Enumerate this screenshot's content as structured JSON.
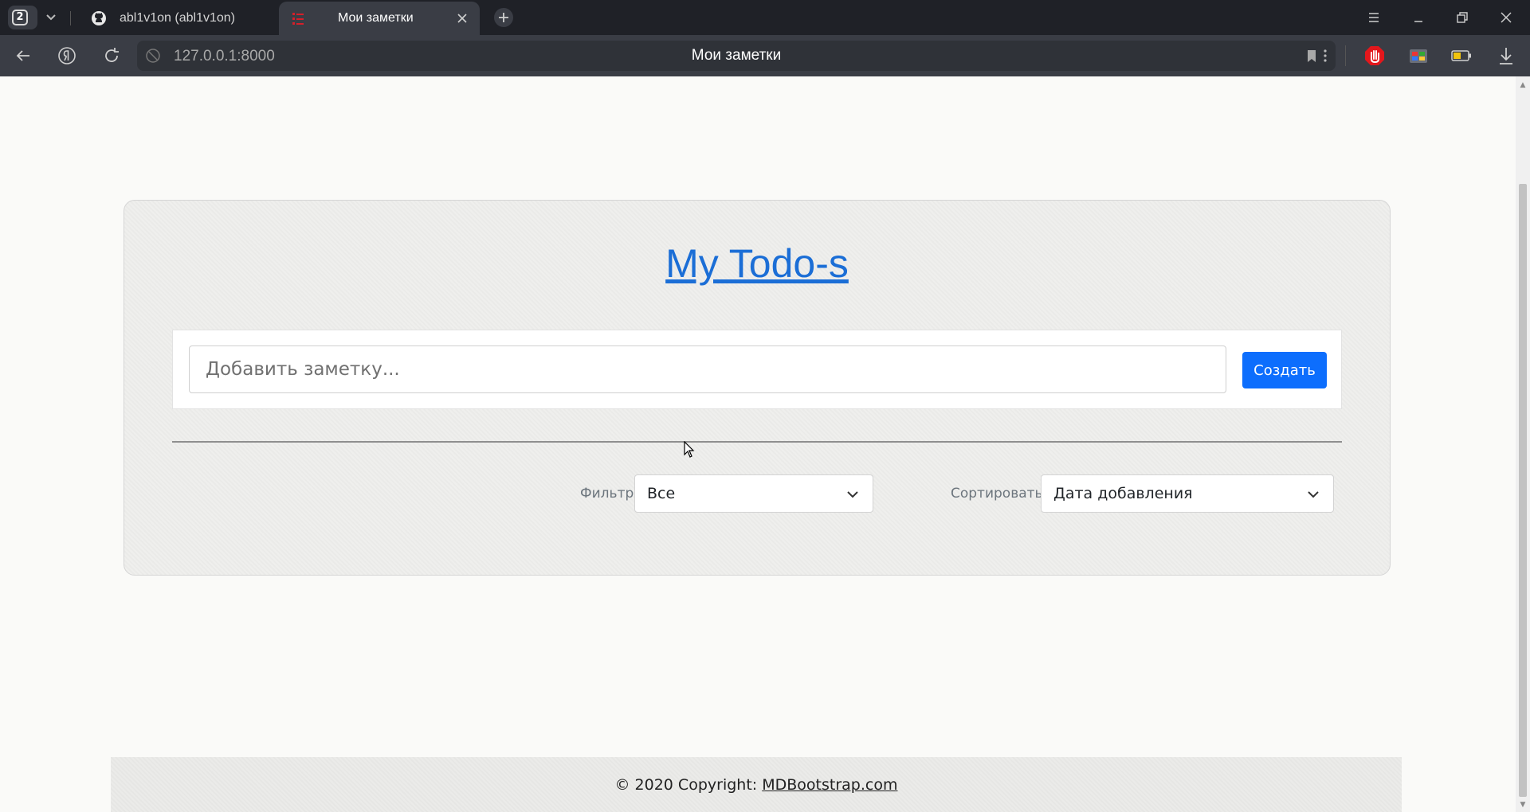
{
  "browser": {
    "tab_count": "2",
    "tabs": [
      {
        "title": "abl1v1on (abl1v1on)",
        "icon": "github-icon"
      },
      {
        "title": "Мои заметки",
        "icon": "app-favicon-icon"
      }
    ],
    "url": "127.0.0.1:8000",
    "page_title": "Мои заметки"
  },
  "page": {
    "title": "My Todo-s",
    "add_placeholder": "Добавить заметку...",
    "create_label": "Создать",
    "filter_label": "Фильтр",
    "filter_value": "Все",
    "sort_label": "Сортировать",
    "sort_value": "Дата добавления"
  },
  "footer": {
    "copyright": "© 2020 Copyright:",
    "link": "MDBootstrap.com"
  },
  "colors": {
    "accent": "#0d6efd",
    "title_link": "#1b6ed6",
    "chrome_dark": "#1f2127",
    "chrome_mid": "#3a3d45"
  }
}
